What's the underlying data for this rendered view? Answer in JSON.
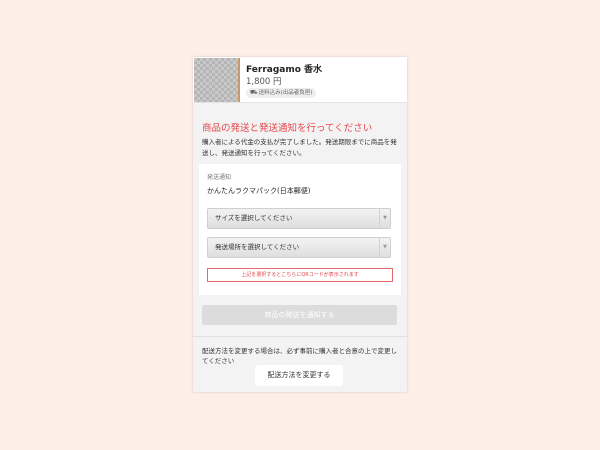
{
  "product": {
    "name": "Ferragamo 香水",
    "price": "1,800 円",
    "badge": "送料込み(出品者負担)"
  },
  "page": {
    "heading": "商品の発送と発送通知を行ってください",
    "description": "購入者による代金の支払が完了しました。発送期限までに商品を発送し、発送通知を行ってください。"
  },
  "shipping_panel": {
    "label": "発送通知",
    "method": "かんたんラクマパック(日本郵便)",
    "size_select": "サイズを選択してください",
    "location_select": "発送場所を選択してください",
    "qr_note": "上記を選択するとこちらにQRコードが表示されます"
  },
  "actions": {
    "notify_button": "商品の発送を通知する",
    "change_note": "配送方法を変更する場合は、必ず事前に購入者と合意の上で変更してください",
    "change_button": "配送方法を変更する"
  },
  "icons": {
    "badge_icon": "truck-icon",
    "select_icon": "chevron-down-icon"
  },
  "colors": {
    "background": "#fdeee7",
    "accent_red": "#e5464b",
    "disabled_button": "#dcdcdc"
  }
}
